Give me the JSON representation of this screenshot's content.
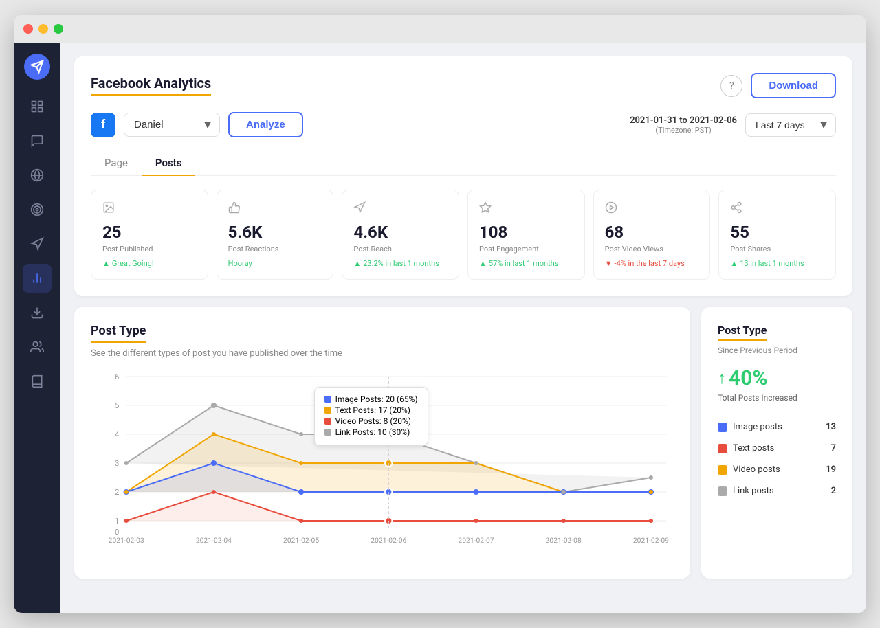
{
  "window": {
    "title": "Facebook Analytics"
  },
  "titlebar": {
    "close": "close",
    "minimize": "minimize",
    "maximize": "maximize"
  },
  "sidebar": {
    "items": [
      {
        "id": "logo",
        "icon": "send",
        "active": false
      },
      {
        "id": "dashboard",
        "icon": "grid",
        "active": false
      },
      {
        "id": "chat",
        "icon": "chat",
        "active": false
      },
      {
        "id": "network",
        "icon": "network",
        "active": false
      },
      {
        "id": "target",
        "icon": "target",
        "active": false
      },
      {
        "id": "megaphone",
        "icon": "megaphone",
        "active": false
      },
      {
        "id": "analytics",
        "icon": "chart",
        "active": true
      },
      {
        "id": "download",
        "icon": "download",
        "active": false
      },
      {
        "id": "audience",
        "icon": "audience",
        "active": false
      },
      {
        "id": "library",
        "icon": "library",
        "active": false
      }
    ]
  },
  "analytics": {
    "title": "Facebook Analytics",
    "help_label": "?",
    "download_label": "Download",
    "facebook_icon": "f",
    "account_name": "Daniel",
    "analyze_label": "Analyze",
    "date_range": "2021-01-31 to 2021-02-06",
    "timezone": "(Timezone: PST)",
    "period_label": "Last 7 days",
    "tabs": [
      {
        "id": "page",
        "label": "Page"
      },
      {
        "id": "posts",
        "label": "Posts",
        "active": true
      }
    ],
    "stats": [
      {
        "icon": "image",
        "value": "25",
        "label": "Post Published",
        "change": "Great Going!",
        "change_type": "up"
      },
      {
        "icon": "thumbs-up",
        "value": "5.6K",
        "label": "Post Reactions",
        "change": "Hooray",
        "change_type": "neutral"
      },
      {
        "icon": "megaphone",
        "value": "4.6K",
        "label": "Post Reach",
        "change": "23.2% in last 1 months",
        "change_type": "up"
      },
      {
        "icon": "star",
        "value": "108",
        "label": "Post Engagement",
        "change": "57% in last 1 months",
        "change_type": "up"
      },
      {
        "icon": "play",
        "value": "68",
        "label": "Post Video Views",
        "change": "-4% in the last 7 days",
        "change_type": "down"
      },
      {
        "icon": "share",
        "value": "55",
        "label": "Post Shares",
        "change": "13 in last 1 months",
        "change_type": "up"
      }
    ]
  },
  "post_type_chart": {
    "title": "Post Type",
    "subtitle": "See the different types of post you have published over the time",
    "x_labels": [
      "2021-02-03",
      "2021-02-04",
      "2021-02-05",
      "2021-02-06",
      "2021-02-07",
      "2021-02-08",
      "2021-02-09"
    ],
    "y_labels": [
      "0",
      "1",
      "2",
      "3",
      "4",
      "5",
      "6"
    ],
    "tooltip": {
      "image_posts": "Image Posts: 20 (65%)",
      "text_posts": "Text Posts: 17 (20%)",
      "video_posts": "Video Posts: 8 (20%)",
      "link_posts": "Link Posts: 10 (30%)"
    },
    "series": {
      "image": {
        "color": "#4a6cf7",
        "points": [
          2,
          3,
          2,
          2,
          2,
          2,
          2
        ]
      },
      "text": {
        "color": "#f0a500",
        "points": [
          2,
          4,
          3,
          3,
          3,
          2,
          2
        ]
      },
      "video": {
        "color": "#e74c3c",
        "points": [
          1,
          2,
          1,
          1,
          1,
          1,
          1
        ]
      },
      "link": {
        "color": "#aaa",
        "points": [
          3,
          5,
          4,
          4,
          3,
          2,
          2.5
        ]
      }
    }
  },
  "post_type_legend": {
    "title": "Post Type",
    "since_label": "Since Previous Period",
    "increase_value": "40%",
    "increase_label": "Total Posts Increased",
    "items": [
      {
        "label": "Image posts",
        "color": "#4a6cf7",
        "count": "13"
      },
      {
        "label": "Text posts",
        "color": "#e74c3c",
        "count": "7"
      },
      {
        "label": "Video posts",
        "color": "#f0a500",
        "count": "19"
      },
      {
        "label": "Link posts",
        "color": "#aaa",
        "count": "2"
      }
    ]
  }
}
